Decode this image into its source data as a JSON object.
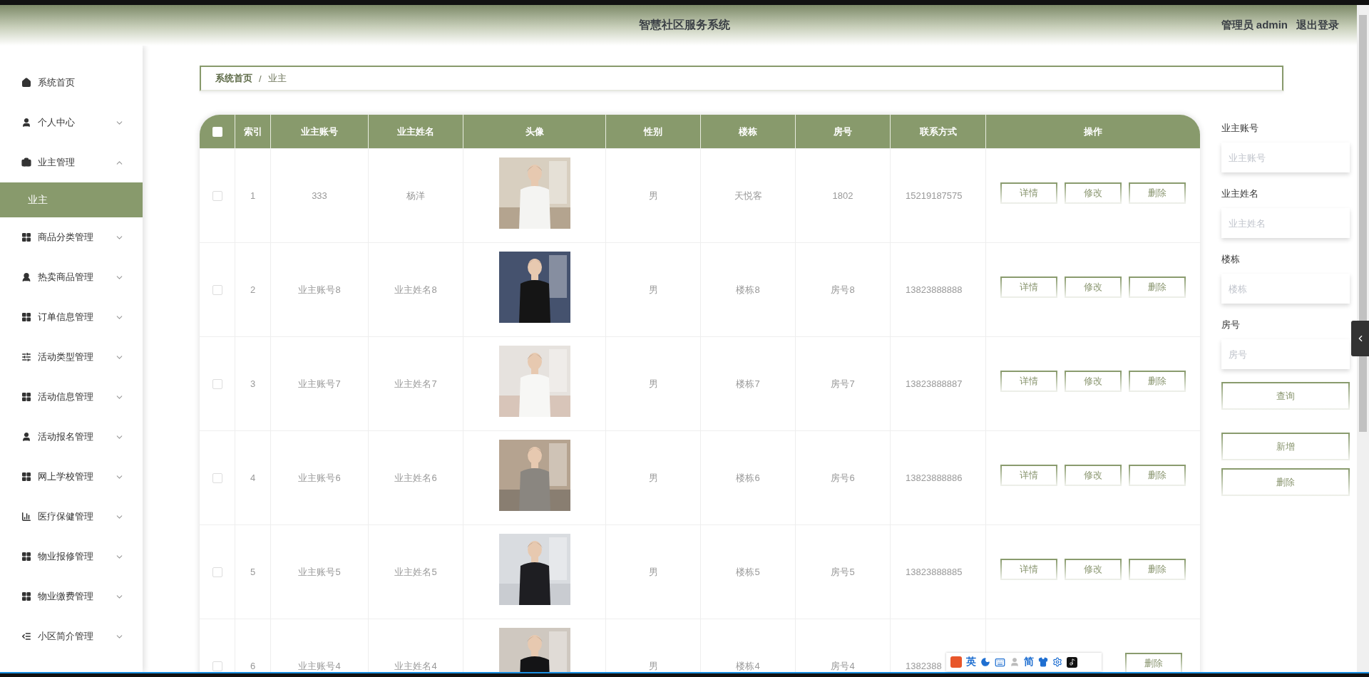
{
  "header": {
    "title": "智慧社区服务系统",
    "user": "管理员 admin",
    "logout": "退出登录"
  },
  "sidebar": {
    "items": [
      {
        "label": "系统首页",
        "kind": "link"
      },
      {
        "label": "个人中心",
        "kind": "menu",
        "expanded": false
      },
      {
        "label": "业主管理",
        "kind": "menu",
        "expanded": true,
        "children": [
          {
            "label": "业主",
            "selected": true
          }
        ]
      },
      {
        "label": "商品分类管理",
        "kind": "menu",
        "expanded": false
      },
      {
        "label": "热卖商品管理",
        "kind": "menu",
        "expanded": false
      },
      {
        "label": "订单信息管理",
        "kind": "menu",
        "expanded": false
      },
      {
        "label": "活动类型管理",
        "kind": "menu",
        "expanded": false
      },
      {
        "label": "活动信息管理",
        "kind": "menu",
        "expanded": false
      },
      {
        "label": "活动报名管理",
        "kind": "menu",
        "expanded": false
      },
      {
        "label": "网上学校管理",
        "kind": "menu",
        "expanded": false
      },
      {
        "label": "医疗保健管理",
        "kind": "menu",
        "expanded": false
      },
      {
        "label": "物业报修管理",
        "kind": "menu",
        "expanded": false
      },
      {
        "label": "物业缴费管理",
        "kind": "menu",
        "expanded": false
      },
      {
        "label": "小区简介管理",
        "kind": "menu",
        "expanded": false
      }
    ]
  },
  "breadcrumb": [
    "系统首页",
    "/",
    "业主"
  ],
  "table": {
    "select_all": {
      "checked": false
    },
    "columns": [
      "索引",
      "业主账号",
      "业主姓名",
      "头像",
      "性别",
      "楼栋",
      "房号",
      "联系方式",
      "操作"
    ],
    "rows": [
      {
        "checked": false,
        "cells": [
          "1",
          "333",
          "杨洋"
        ],
        "avatar": {
          "kind": "picture"
        },
        "rest": [
          "男",
          "天悦客",
          "1802",
          "15219187575"
        ],
        "actions": [
          "详情",
          "修改",
          "删除"
        ]
      },
      {
        "checked": false,
        "cells": [
          "2",
          "业主账号8",
          "业主姓名8"
        ],
        "avatar": {
          "kind": "picture"
        },
        "rest": [
          "男",
          "楼栋8",
          "房号8",
          "13823888888"
        ],
        "actions": [
          "详情",
          "修改",
          "删除"
        ]
      },
      {
        "checked": false,
        "cells": [
          "3",
          "业主账号7",
          "业主姓名7"
        ],
        "avatar": {
          "kind": "picture"
        },
        "rest": [
          "男",
          "楼栋7",
          "房号7",
          "13823888887"
        ],
        "actions": [
          "详情",
          "修改",
          "删除"
        ]
      },
      {
        "checked": false,
        "cells": [
          "4",
          "业主账号6",
          "业主姓名6"
        ],
        "avatar": {
          "kind": "picture"
        },
        "rest": [
          "男",
          "楼栋6",
          "房号6",
          "13823888886"
        ],
        "actions": [
          "详情",
          "修改",
          "删除"
        ]
      },
      {
        "checked": false,
        "cells": [
          "5",
          "业主账号5",
          "业主姓名5"
        ],
        "avatar": {
          "kind": "picture"
        },
        "rest": [
          "男",
          "楼栋5",
          "房号5",
          "13823888885"
        ],
        "actions": [
          "详情",
          "修改",
          "删除"
        ]
      },
      {
        "checked": false,
        "cells": [
          "6",
          "业主账号4",
          "业主姓名4"
        ],
        "avatar": {
          "kind": "picture"
        },
        "rest": [
          "男",
          "楼栋4",
          "房号4",
          "1382388"
        ],
        "actions": [
          "删除"
        ]
      }
    ]
  },
  "search": {
    "fields": [
      {
        "label": "业主账号",
        "placeholder": "业主账号"
      },
      {
        "label": "业主姓名",
        "placeholder": "业主姓名"
      },
      {
        "label": "楼栋",
        "placeholder": "楼栋"
      },
      {
        "label": "房号",
        "placeholder": "房号"
      }
    ],
    "query_button": "查询",
    "add_button": "新增",
    "delete_button": "删除"
  },
  "ime_toolbar": {
    "language": "英",
    "script": "简"
  }
}
